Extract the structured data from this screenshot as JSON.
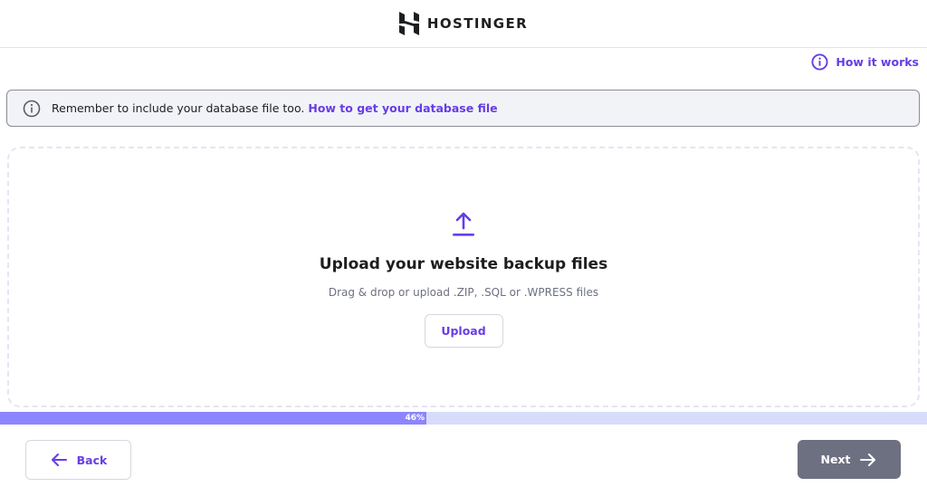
{
  "header": {
    "brand": "HOSTINGER",
    "logo_icon": "hostinger-logo-icon"
  },
  "help_link": {
    "label": "How it works",
    "icon": "info-icon"
  },
  "notice": {
    "icon": "info-icon",
    "text": "Remember to include your database file too.",
    "link": "How to get your database file"
  },
  "dropzone": {
    "icon": "upload-arrow-icon",
    "title": "Upload your website backup files",
    "subtitle": "Drag & drop or upload .ZIP, .SQL or .WPRESS files",
    "upload_label": "Upload"
  },
  "progress": {
    "percent": 46,
    "label": "46%"
  },
  "footer": {
    "back_label": "Back",
    "back_icon": "arrow-left-icon",
    "next_label": "Next",
    "next_icon": "arrow-right-icon"
  },
  "colors": {
    "accent": "#673de6",
    "progress_fill": "#8c85ff",
    "progress_track": "#d8dcfb",
    "next_button": "#6d7081",
    "notice_bg": "#f2f3f6"
  }
}
